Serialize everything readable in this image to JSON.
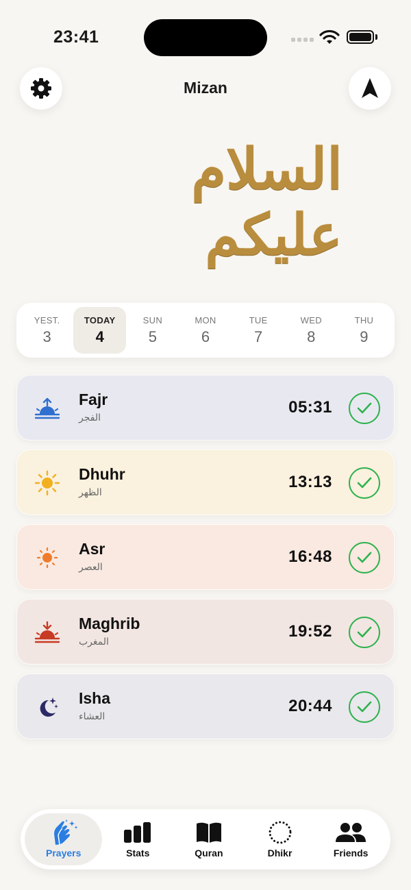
{
  "status": {
    "time": "23:41"
  },
  "header": {
    "title": "Mizan",
    "settings_icon": "gear-icon",
    "nav_icon": "navigation-arrow-icon"
  },
  "greeting": {
    "arabic": "السلام عليكم",
    "color": "#b98d3e"
  },
  "days": [
    {
      "label": "YEST.",
      "number": "3",
      "selected": false
    },
    {
      "label": "TODAY",
      "number": "4",
      "selected": true
    },
    {
      "label": "SUN",
      "number": "5",
      "selected": false
    },
    {
      "label": "MON",
      "number": "6",
      "selected": false
    },
    {
      "label": "TUE",
      "number": "7",
      "selected": false
    },
    {
      "label": "WED",
      "number": "8",
      "selected": false
    },
    {
      "label": "THU",
      "number": "9",
      "selected": false
    }
  ],
  "prayers": [
    {
      "name": "Fajr",
      "arabic": "الفجر",
      "time": "05:31",
      "done": true,
      "icon": "sunrise-icon",
      "bg": "#e8e9f0",
      "accent": "#2f6fd0"
    },
    {
      "name": "Dhuhr",
      "arabic": "الظهر",
      "time": "13:13",
      "done": true,
      "icon": "sun-icon",
      "bg": "#faf1de",
      "accent": "#f2b01e"
    },
    {
      "name": "Asr",
      "arabic": "العصر",
      "time": "16:48",
      "done": true,
      "icon": "sun-small-icon",
      "bg": "#f9e9e0",
      "accent": "#ef7c2c"
    },
    {
      "name": "Maghrib",
      "arabic": "المغرب",
      "time": "19:52",
      "done": true,
      "icon": "sunset-icon",
      "bg": "#f2e6e2",
      "accent": "#c73a24"
    },
    {
      "name": "Isha",
      "arabic": "العشاء",
      "time": "20:44",
      "done": true,
      "icon": "moon-stars-icon",
      "bg": "#e9e8ec",
      "accent": "#2c2a66"
    }
  ],
  "check_color": "#2fb24f",
  "tabs": [
    {
      "label": "Prayers",
      "icon": "praying-hands-icon",
      "active": true
    },
    {
      "label": "Stats",
      "icon": "bar-chart-icon",
      "active": false
    },
    {
      "label": "Quran",
      "icon": "book-icon",
      "active": false
    },
    {
      "label": "Dhikr",
      "icon": "dotted-circle-icon",
      "active": false
    },
    {
      "label": "Friends",
      "icon": "people-icon",
      "active": false
    }
  ],
  "active_tab_color": "#2a7de1"
}
